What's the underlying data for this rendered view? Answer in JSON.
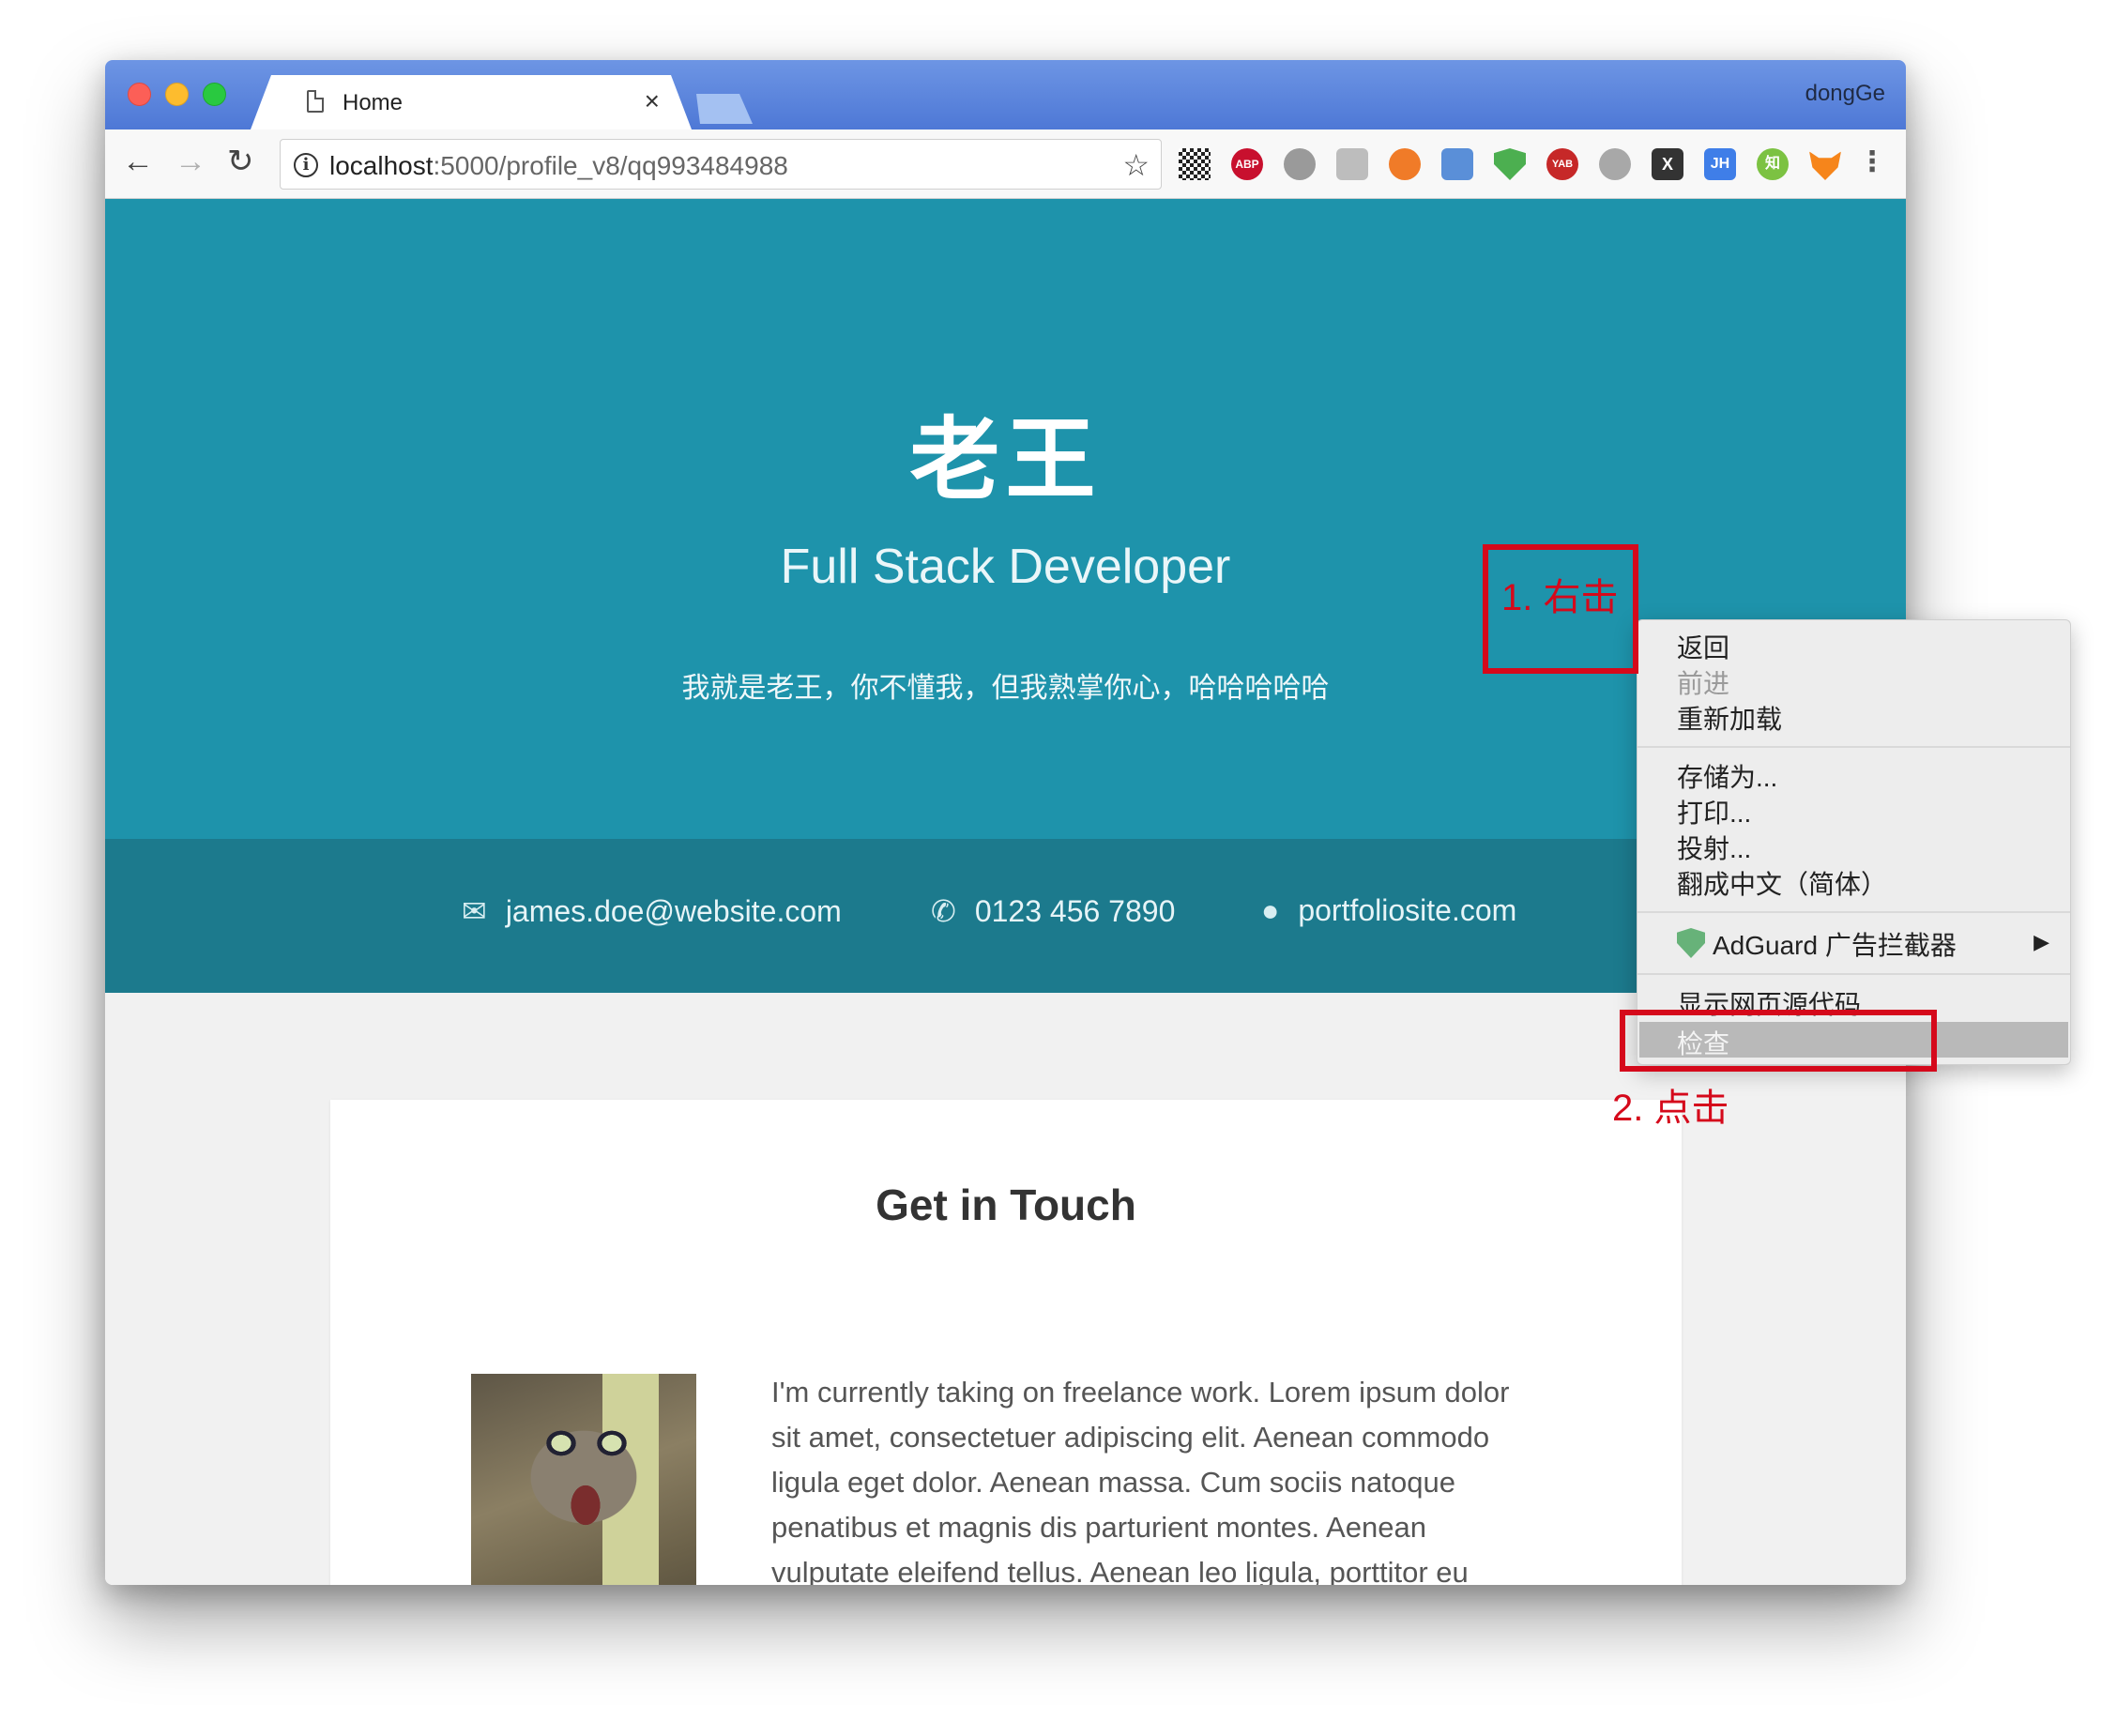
{
  "browser": {
    "tab_title": "Home",
    "tab_close": "×",
    "profile": "dongGe",
    "nav": {
      "back": "←",
      "forward": "→",
      "reload": "↻"
    },
    "url_host": "localhost",
    "url_path": ":5000/profile_v8/qq993484988",
    "extensions": [
      "ABP",
      "YAB",
      "JH",
      "知",
      "X"
    ]
  },
  "hero": {
    "name": "老王",
    "role": "Full Stack Developer",
    "motto": "我就是老王，你不懂我，但我熟掌你心，哈哈哈哈哈"
  },
  "contact": {
    "email": "james.doe@website.com",
    "phone": "0123 456 7890",
    "website": "portfoliosite.com"
  },
  "card": {
    "heading": "Get in Touch",
    "body": "I'm currently taking on freelance work. Lorem ipsum dolor sit amet, consectetuer adipiscing elit. Aenean commodo ligula eget dolor. Aenean massa. Cum sociis natoque penatibus et magnis dis parturient montes. Aenean vulputate eleifend tellus. Aenean leo ligula, porttitor eu"
  },
  "context_menu": {
    "back": "返回",
    "forward": "前进",
    "reload": "重新加载",
    "save_as": "存储为...",
    "print": "打印...",
    "cast": "投射...",
    "translate": "翻成中文（简体）",
    "adguard": "AdGuard 广告拦截器",
    "view_source": "显示网页源代码",
    "inspect": "检查"
  },
  "annotations": {
    "step1": "1. 右击",
    "step2": "2. 点击"
  },
  "colors": {
    "hero": "#1e93ab",
    "contact_bar": "#1c7a8d",
    "annotation": "#d5091b"
  }
}
